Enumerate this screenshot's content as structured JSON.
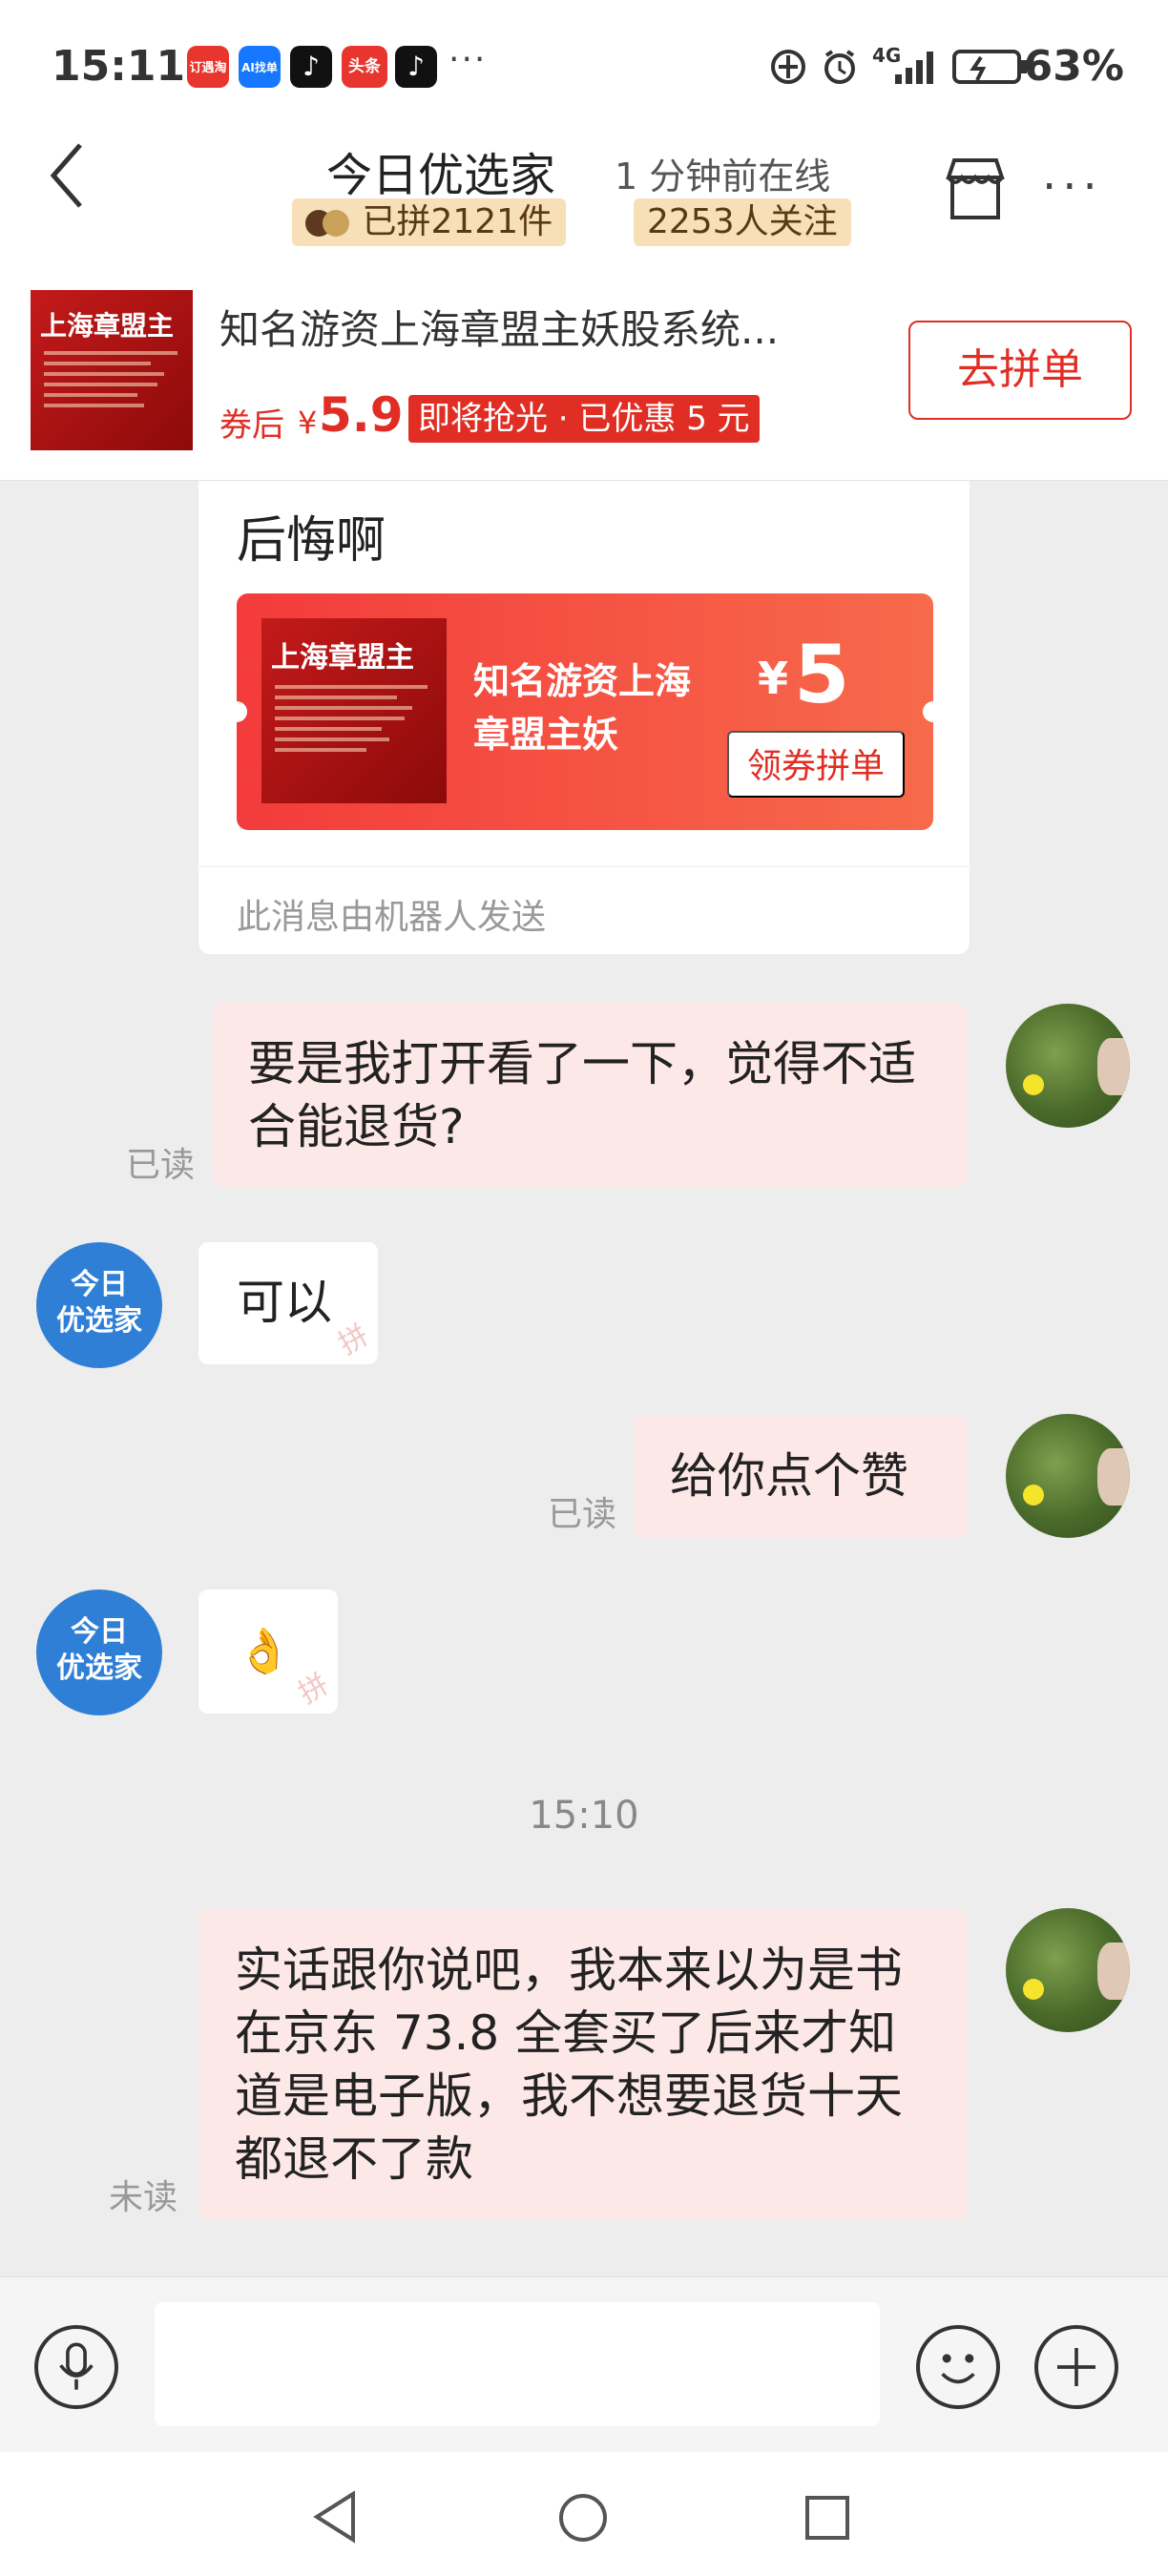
{
  "status_bar": {
    "time": "15:11",
    "app_icons": [
      {
        "name": "taobao-special-icon",
        "label": "订遇淘",
        "color": "#e8352e"
      },
      {
        "name": "alipay-icon",
        "label": "AI找单",
        "color": "#1677ff"
      },
      {
        "name": "tiktok-icon",
        "label": "♪",
        "color": "#111111"
      },
      {
        "name": "toutiao-icon",
        "label": "头条",
        "color": "#e8352e"
      },
      {
        "name": "tiktok-icon-2",
        "label": "♪",
        "color": "#111111"
      }
    ],
    "more": "···",
    "network": "4G",
    "battery": "63%"
  },
  "header": {
    "title": "今日优选家",
    "online_status": "1 分钟前在线",
    "group_count": "已拼2121件",
    "followers": "2253人关注"
  },
  "product": {
    "thumb_title": "上海章盟主",
    "title": "知名游资上海章盟主妖股系统...",
    "price_label": "券后",
    "currency": "¥",
    "price": "5.9",
    "promo_tag": "即将抢光 · 已优惠 5 元",
    "action_label": "去拼单"
  },
  "bot_card": {
    "text": "后悔啊",
    "coupon": {
      "thumb_title": "上海章盟主",
      "title": "知名游资上海章盟主妖",
      "currency": "¥",
      "amount": "5",
      "button": "领券拼单"
    },
    "footer": "此消息由机器人发送"
  },
  "messages": [
    {
      "side": "out",
      "text": "要是我打开看了一下，觉得不适合能退货?",
      "status": "已读"
    },
    {
      "side": "in",
      "sender": "今日优选家",
      "text": "可以"
    },
    {
      "side": "out",
      "text": "给你点个赞",
      "status": "已读"
    },
    {
      "side": "in",
      "sender": "今日优选家",
      "text": "👌"
    },
    {
      "side": "out",
      "text": "实话跟你说吧，我本来以为是书在京东 73.8 全套买了后来才知道是电子版，我不想要退货十天都退不了款",
      "status": "未读"
    }
  ],
  "time_divider": "15:10",
  "shop_avatar": {
    "line1": "今日",
    "line2": "优选家",
    "color": "#2f7fd6"
  },
  "input_bar": {
    "placeholder": ""
  },
  "colors": {
    "accent": "#e02e24",
    "out_bubble": "#fde8e8",
    "badge": "#f7dfb8"
  }
}
